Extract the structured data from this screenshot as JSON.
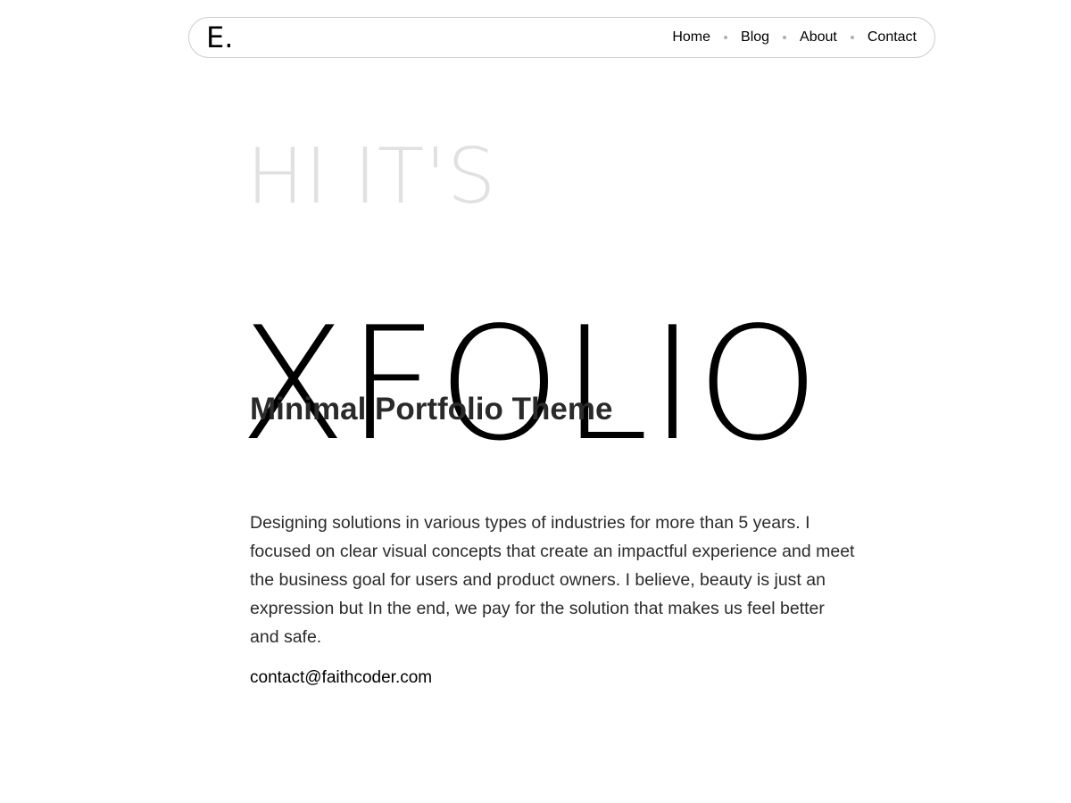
{
  "header": {
    "logo_text": "E.",
    "nav": [
      {
        "label": "Home"
      },
      {
        "label": "Blog"
      },
      {
        "label": "About"
      },
      {
        "label": "Contact"
      }
    ]
  },
  "hero": {
    "pre_title": "HI IT'S",
    "title": "XFOLIO",
    "subtitle": "Minimal Portfolio Theme"
  },
  "about": {
    "description": "Designing solutions in various types of industries for more than 5 years. I focused on clear visual concepts that create an impactful experience and meet the business goal for users and product owners. I believe, beauty is just an expression but In the end, we pay for the solution that makes us feel better and safe.",
    "email": "contact@faithcoder.com"
  },
  "colors": {
    "pre_title": "#e1e1e1",
    "text": "#2b2b2b",
    "nav_border": "#cfcfcf",
    "dot": "#b0b0b0"
  }
}
